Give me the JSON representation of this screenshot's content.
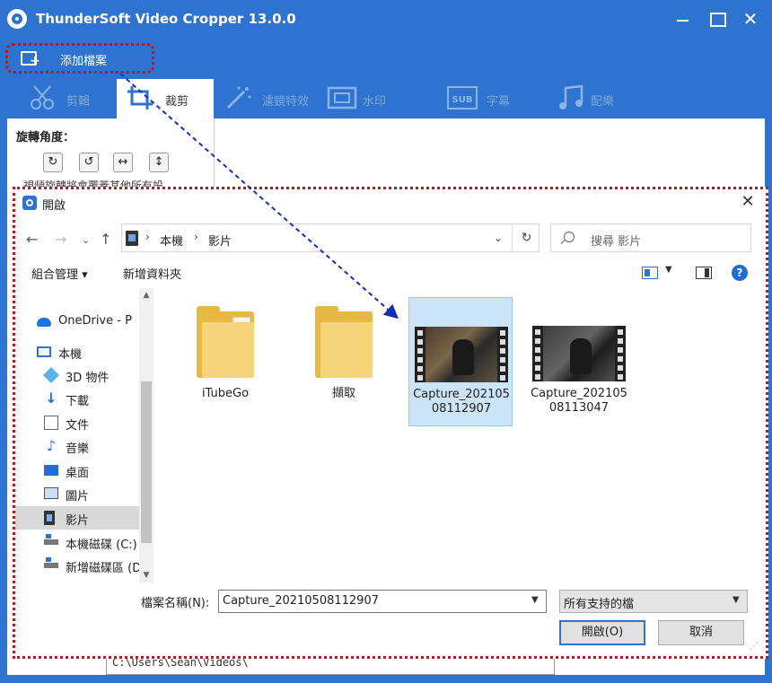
{
  "app": {
    "title": "ThunderSoft Video Cropper 13.0.0",
    "add_file_label": "添加檔案",
    "tabs": [
      {
        "label": "剪輯",
        "icon": "cut-icon"
      },
      {
        "label": "裁剪",
        "icon": "crop-icon"
      },
      {
        "label": "濾鏡特效",
        "icon": "magic-wand-icon"
      },
      {
        "label": "水印",
        "icon": "watermark-icon"
      },
      {
        "label": "字幕",
        "icon": "subtitle-icon"
      },
      {
        "label": "配樂",
        "icon": "music-icon"
      }
    ],
    "active_tab": "裁剪",
    "rotate_label": "旋轉角度：",
    "rotate_buttons": [
      "rotate-clockwise-icon",
      "rotate-counterclockwise-icon",
      "flip-horizontal-icon",
      "flip-vertical-icon"
    ],
    "partial_text": "視頻旋轉將會覆蓋其他所有設",
    "output_path": "C:\\Users\\Sean\\Videos\\",
    "colors": {
      "accent": "#2f73d0",
      "annotation_red": "#c4151c",
      "annotation_blue": "#1530b8"
    }
  },
  "dialog": {
    "title": "開啟",
    "breadcrumbs": [
      "本機",
      "影片"
    ],
    "search_placeholder": "搜尋 影片",
    "organize_label": "組合管理",
    "new_folder_label": "新增資料夾",
    "nav_items": [
      {
        "label": "OneDrive - Pe",
        "icon": "onedrive-icon",
        "top": true
      },
      {
        "label": "本機",
        "icon": "computer-icon",
        "top": true
      },
      {
        "label": "3D 物件",
        "icon": "3d-objects-icon"
      },
      {
        "label": "下載",
        "icon": "downloads-icon"
      },
      {
        "label": "文件",
        "icon": "documents-icon"
      },
      {
        "label": "音樂",
        "icon": "music-icon"
      },
      {
        "label": "桌面",
        "icon": "desktop-icon"
      },
      {
        "label": "圖片",
        "icon": "pictures-icon"
      },
      {
        "label": "影片",
        "icon": "videos-icon",
        "selected": true
      },
      {
        "label": "本機磁碟 (C:)",
        "icon": "local-disk-icon"
      },
      {
        "label": "新增磁碟區 (D",
        "icon": "drive-icon"
      }
    ],
    "files": [
      {
        "name": "iTubeGo",
        "type": "folder"
      },
      {
        "name": "擷取",
        "type": "folder"
      },
      {
        "name": "Capture_20210508112907",
        "type": "video",
        "selected": true
      },
      {
        "name": "Capture_20210508113047",
        "type": "video"
      }
    ],
    "file_name_label": "檔案名稱(N):",
    "file_name_value": "Capture_20210508112907",
    "filter_value": "所有支持的檔",
    "open_button": "開啟(O)",
    "cancel_button": "取消"
  }
}
